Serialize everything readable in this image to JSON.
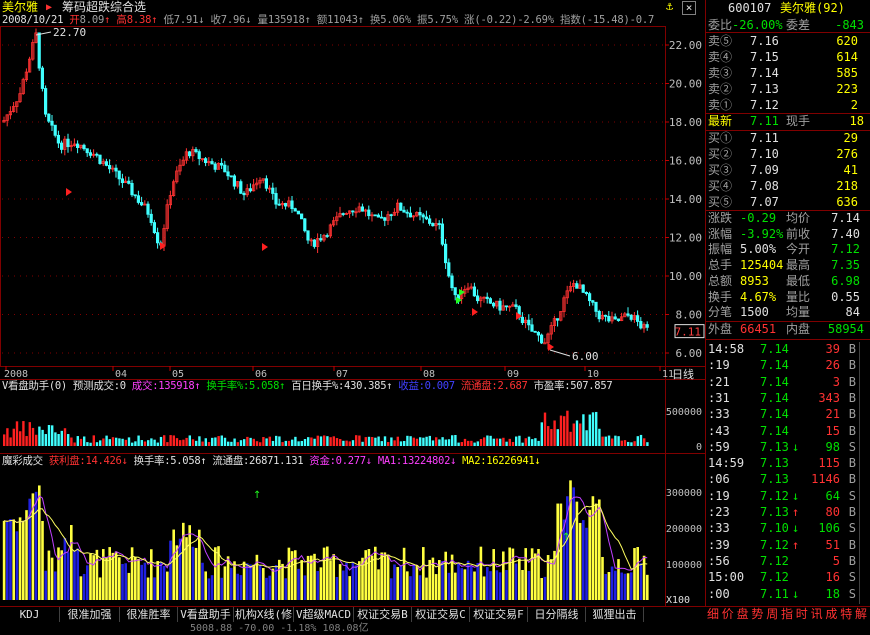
{
  "header": {
    "stock_name": "美尔雅",
    "arrow": "▶",
    "menu_title": "筹码超跌综合选",
    "anchor_icon": "⚓",
    "close_icon": "×",
    "info_line": [
      {
        "t": "2008/10/21 ",
        "c": "wht"
      },
      {
        "t": "开",
        "c": "red"
      },
      {
        "t": "8.09",
        "c": "gry"
      },
      {
        "t": "↑",
        "c": "red"
      },
      {
        "t": " 高",
        "c": "red"
      },
      {
        "t": "8.38",
        "c": "red"
      },
      {
        "t": "↑",
        "c": "red"
      },
      {
        "t": " 低",
        "c": "gry"
      },
      {
        "t": "7.91",
        "c": "gry"
      },
      {
        "t": "↓",
        "c": "gry"
      },
      {
        "t": " 收",
        "c": "gry"
      },
      {
        "t": "7.96",
        "c": "gry"
      },
      {
        "t": "↓",
        "c": "gry"
      },
      {
        "t": " 量",
        "c": "gry"
      },
      {
        "t": "135918",
        "c": "gry"
      },
      {
        "t": "↑",
        "c": "gry"
      },
      {
        "t": " 额",
        "c": "gry"
      },
      {
        "t": "11043",
        "c": "gry"
      },
      {
        "t": "↑",
        "c": "gry"
      },
      {
        "t": " 换",
        "c": "gry"
      },
      {
        "t": "5.06%",
        "c": "gry"
      },
      {
        "t": " 振",
        "c": "gry"
      },
      {
        "t": "5.75%",
        "c": "gry"
      },
      {
        "t": " 涨",
        "c": "gry"
      },
      {
        "t": "(-0.22)-2.69%",
        "c": "gry"
      },
      {
        "t": " 指数",
        "c": "gry"
      },
      {
        "t": "(-15.48)-0.7",
        "c": "gry"
      }
    ]
  },
  "main_chart": {
    "y_ticks": [
      "22.00",
      "20.00",
      "18.00",
      "16.00",
      "14.00",
      "12.00",
      "10.00",
      "8.00",
      "6.00"
    ],
    "high_label": "22.70",
    "low_label": "6.00",
    "current_price_tag": "7.11",
    "x_labels": [
      "2008",
      "04",
      "05",
      "06",
      "07",
      "08",
      "09",
      "10",
      "11"
    ],
    "x_unit_label": "日线"
  },
  "panel2": {
    "legend": [
      {
        "t": "V看盘助手(0) ",
        "c": "wht"
      },
      {
        "t": "预测成交:0 ",
        "c": "wht"
      },
      {
        "t": "成交:135918",
        "c": "mag"
      },
      {
        "t": "↑ ",
        "c": "mag"
      },
      {
        "t": "换手率%:5.058",
        "c": "grn"
      },
      {
        "t": "↑ ",
        "c": "grn"
      },
      {
        "t": "百日换手%:430.385",
        "c": "wht"
      },
      {
        "t": "↑ ",
        "c": "wht"
      },
      {
        "t": "收益:0.007 ",
        "c": "blu"
      },
      {
        "t": "流通盘:2.687 ",
        "c": "red"
      },
      {
        "t": "市盈率:507.857",
        "c": "wht"
      }
    ],
    "y_ticks": [
      "500000",
      "0"
    ]
  },
  "panel3": {
    "legend": [
      {
        "t": "魔彩成交 ",
        "c": "wht"
      },
      {
        "t": "获利盘:14.426",
        "c": "red"
      },
      {
        "t": "↓ ",
        "c": "red"
      },
      {
        "t": "换手率:5.058",
        "c": "wht"
      },
      {
        "t": "↑ ",
        "c": "wht"
      },
      {
        "t": "流通盘:26871.131 ",
        "c": "wht"
      },
      {
        "t": "资金:0.277",
        "c": "mag"
      },
      {
        "t": "↓ ",
        "c": "mag"
      },
      {
        "t": "MA1:13224802",
        "c": "mag"
      },
      {
        "t": "↓ ",
        "c": "mag"
      },
      {
        "t": "MA2:16226941",
        "c": "yel"
      },
      {
        "t": "↓",
        "c": "yel"
      }
    ],
    "y_ticks": [
      "300000",
      "200000",
      "100000"
    ],
    "unit_label": "X100"
  },
  "bottom_tabs": [
    "KDJ",
    "很准加强",
    "很准胜率",
    "V看盘助手",
    "机构X线(修",
    "V超级MACD",
    "权证交易B",
    "权证交易C",
    "权证交易F",
    "日分隔线",
    "狐狸出击"
  ],
  "bottom_right_tabs": [
    "细",
    "价",
    "盘",
    "势",
    "周",
    "指",
    "时",
    "讯",
    "成",
    "特",
    "解"
  ],
  "status_bar": "5008.88  -70.00  -1.18%  108.08亿",
  "sidebar": {
    "code": "600107",
    "name": "美尔雅(92)",
    "ratio_label": "委比",
    "ratio_value": "-26.00%",
    "diff_label": "委差",
    "diff_value": "-843",
    "asks": [
      {
        "label": "卖⑤",
        "price": "7.16",
        "vol": "620"
      },
      {
        "label": "卖④",
        "price": "7.15",
        "vol": "614"
      },
      {
        "label": "卖③",
        "price": "7.14",
        "vol": "585"
      },
      {
        "label": "卖②",
        "price": "7.13",
        "vol": "223"
      },
      {
        "label": "卖①",
        "price": "7.12",
        "vol": "2"
      }
    ],
    "last_label": "最新",
    "last_price": "7.11",
    "cur_vol_label": "现手",
    "cur_vol": "18",
    "bids": [
      {
        "label": "买①",
        "price": "7.11",
        "vol": "29"
      },
      {
        "label": "买②",
        "price": "7.10",
        "vol": "276"
      },
      {
        "label": "买③",
        "price": "7.09",
        "vol": "41"
      },
      {
        "label": "买④",
        "price": "7.08",
        "vol": "218"
      },
      {
        "label": "买⑤",
        "price": "7.07",
        "vol": "636"
      }
    ],
    "stats": [
      {
        "l1": "涨跌",
        "v1": "-0.29",
        "c1": "grn",
        "l2": "均价",
        "v2": "7.14",
        "c2": "wht"
      },
      {
        "l1": "涨幅",
        "v1": "-3.92%",
        "c1": "grn",
        "l2": "前收",
        "v2": "7.40",
        "c2": "wht"
      },
      {
        "l1": "振幅",
        "v1": "5.00%",
        "c1": "wht",
        "l2": "今开",
        "v2": "7.12",
        "c2": "grn"
      },
      {
        "l1": "总手",
        "v1": "125404",
        "c1": "yel",
        "l2": "最高",
        "v2": "7.35",
        "c2": "grn"
      },
      {
        "l1": "总额",
        "v1": "8953",
        "c1": "yel",
        "l2": "最低",
        "v2": "6.98",
        "c2": "grn"
      },
      {
        "l1": "换手",
        "v1": "4.67%",
        "c1": "yel",
        "l2": "量比",
        "v2": "0.55",
        "c2": "wht"
      },
      {
        "l1": "分笔",
        "v1": "1500",
        "c1": "wht",
        "l2": "均量",
        "v2": "84",
        "c2": "wht"
      }
    ],
    "outer_label": "外盘",
    "outer_value": "66451",
    "inner_label": "内盘",
    "inner_value": "58954",
    "ticks": [
      {
        "time": "14:58",
        "price": "7.14",
        "arrow": "",
        "vol": "39",
        "vc": "red",
        "bs": "B"
      },
      {
        "time": ":19",
        "price": "7.14",
        "arrow": "",
        "vol": "26",
        "vc": "red",
        "bs": "B"
      },
      {
        "time": ":21",
        "price": "7.14",
        "arrow": "",
        "vol": "3",
        "vc": "red",
        "bs": "B"
      },
      {
        "time": ":31",
        "price": "7.14",
        "arrow": "",
        "vol": "343",
        "vc": "red",
        "bs": "B"
      },
      {
        "time": ":33",
        "price": "7.14",
        "arrow": "",
        "vol": "21",
        "vc": "red",
        "bs": "B"
      },
      {
        "time": ":43",
        "price": "7.14",
        "arrow": "",
        "vol": "15",
        "vc": "red",
        "bs": "B"
      },
      {
        "time": ":59",
        "price": "7.13",
        "arrow": "↓",
        "vol": "98",
        "vc": "grn",
        "bs": "S"
      },
      {
        "time": "14:59",
        "price": "7.13",
        "arrow": "",
        "vol": "115",
        "vc": "red",
        "bs": "B"
      },
      {
        "time": ":06",
        "price": "7.13",
        "arrow": "",
        "vol": "1146",
        "vc": "red",
        "bs": "B"
      },
      {
        "time": ":19",
        "price": "7.12",
        "arrow": "↓",
        "vol": "64",
        "vc": "grn",
        "bs": "S"
      },
      {
        "time": ":23",
        "price": "7.13",
        "arrow": "↑",
        "vol": "80",
        "vc": "red",
        "bs": "B"
      },
      {
        "time": ":33",
        "price": "7.10",
        "arrow": "↓",
        "vol": "106",
        "vc": "grn",
        "bs": "S"
      },
      {
        "time": ":39",
        "price": "7.12",
        "arrow": "↑",
        "vol": "51",
        "vc": "red",
        "bs": "B"
      },
      {
        "time": ":56",
        "price": "7.12",
        "arrow": "",
        "vol": "5",
        "vc": "red",
        "bs": "B"
      },
      {
        "time": "15:00",
        "price": "7.12",
        "arrow": "",
        "vol": "16",
        "vc": "red",
        "bs": "S"
      },
      {
        "time": ":00",
        "price": "7.11",
        "arrow": "↓",
        "vol": "18",
        "vc": "grn",
        "bs": "S"
      }
    ]
  }
}
